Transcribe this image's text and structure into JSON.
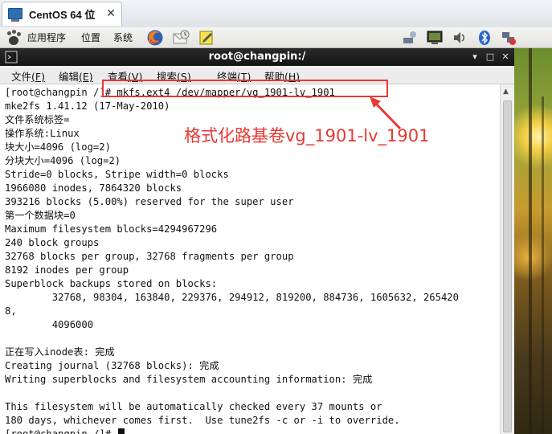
{
  "vm_tab": {
    "title": "CentOS 64 位",
    "close_glyph": "✕"
  },
  "panel": {
    "menus": [
      "应用程序",
      "位置",
      "系统"
    ],
    "launchers": [
      "firefox-icon",
      "mail-icon",
      "notes-icon"
    ],
    "tray": [
      "network-icon",
      "monitor-icon",
      "volume-icon",
      "bluetooth-icon",
      "network-status-icon"
    ]
  },
  "terminal": {
    "title": "root@changpin:/",
    "title_icon": "terminal-icon",
    "buttons": {
      "minimize": "▾",
      "maximize": "□",
      "close": "✕"
    },
    "menu": [
      {
        "label": "文件",
        "mnemonic": "(F)"
      },
      {
        "label": "编辑",
        "mnemonic": "(E)"
      },
      {
        "label": "查看",
        "mnemonic": "(V)"
      },
      {
        "label": "搜索",
        "mnemonic": "(S)"
      },
      {
        "label": "终端",
        "mnemonic": "(T)"
      },
      {
        "label": "帮助",
        "mnemonic": "(H)"
      }
    ],
    "lines": [
      "[root@changpin /]# mkfs.ext4 /dev/mapper/vg_1901-lv_1901",
      "mke2fs 1.41.12 (17-May-2010)",
      "文件系统标签=",
      "操作系统:Linux",
      "块大小=4096 (log=2)",
      "分块大小=4096 (log=2)",
      "Stride=0 blocks, Stripe width=0 blocks",
      "1966080 inodes, 7864320 blocks",
      "393216 blocks (5.00%) reserved for the super user",
      "第一个数据块=0",
      "Maximum filesystem blocks=4294967296",
      "240 block groups",
      "32768 blocks per group, 32768 fragments per group",
      "8192 inodes per group",
      "Superblock backups stored on blocks:",
      "        32768, 98304, 163840, 229376, 294912, 819200, 884736, 1605632, 265420",
      "8,",
      "        4096000",
      "",
      "正在写入inode表: 完成",
      "Creating journal (32768 blocks): 完成",
      "Writing superblocks and filesystem accounting information: 完成",
      "",
      "This filesystem will be automatically checked every 37 mounts or",
      "180 days, whichever comes first.  Use tune2fs -c or -i to override.",
      "[root@changpin /]# "
    ]
  },
  "annotation": {
    "text": "格式化路基卷vg_1901-lv_1901",
    "color": "#e53935"
  }
}
